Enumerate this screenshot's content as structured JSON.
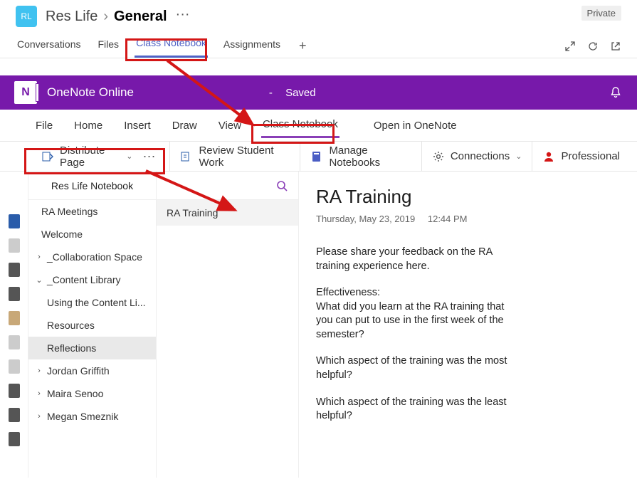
{
  "header": {
    "channel_initials": "RL",
    "team_name": "Res Life",
    "channel_name": "General",
    "private_label": "Private"
  },
  "top_tabs": {
    "items": [
      "Conversations",
      "Files",
      "Class Notebook",
      "Assignments"
    ],
    "active_index": 2
  },
  "onenote": {
    "app_title": "OneNote Online",
    "save_indicator_dash": "-",
    "save_indicator": "Saved"
  },
  "ribbon": {
    "items": [
      "File",
      "Home",
      "Insert",
      "Draw",
      "View",
      "Class Notebook",
      "Open in OneNote"
    ],
    "active_index": 5
  },
  "toolbar": {
    "distribute_label": "Distribute Page",
    "review_label": "Review Student Work",
    "manage_label": "Manage Notebooks",
    "connections_label": "Connections",
    "professional_label": "Professional"
  },
  "notebook": {
    "title": "Res Life Notebook",
    "sections": [
      {
        "label": "RA Meetings",
        "indent": 1,
        "caret": ""
      },
      {
        "label": "Welcome",
        "indent": 1,
        "caret": ""
      },
      {
        "label": "_Collaboration Space",
        "indent": 0,
        "caret": ">"
      },
      {
        "label": "_Content Library",
        "indent": 0,
        "caret": "v"
      },
      {
        "label": "Using the Content Li...",
        "indent": 2,
        "caret": ""
      },
      {
        "label": "Resources",
        "indent": 2,
        "caret": ""
      },
      {
        "label": "Reflections",
        "indent": 2,
        "caret": "",
        "selected": true
      },
      {
        "label": "Jordan Griffith",
        "indent": 0,
        "caret": ">"
      },
      {
        "label": "Maira Senoo",
        "indent": 0,
        "caret": ">"
      },
      {
        "label": "Megan Smeznik",
        "indent": 0,
        "caret": ">"
      }
    ]
  },
  "pages": {
    "items": [
      "RA Training"
    ],
    "selected_index": 0
  },
  "page": {
    "title": "RA Training",
    "date": "Thursday, May 23, 2019",
    "time": "12:44 PM",
    "body": [
      "Please share your feedback on the RA training experience here.",
      "Effectiveness:\nWhat did you learn at the RA training that you can put to use in the first week of the semester?",
      "Which aspect of the training was the most helpful?",
      "Which aspect of the training was the least helpful?"
    ]
  }
}
